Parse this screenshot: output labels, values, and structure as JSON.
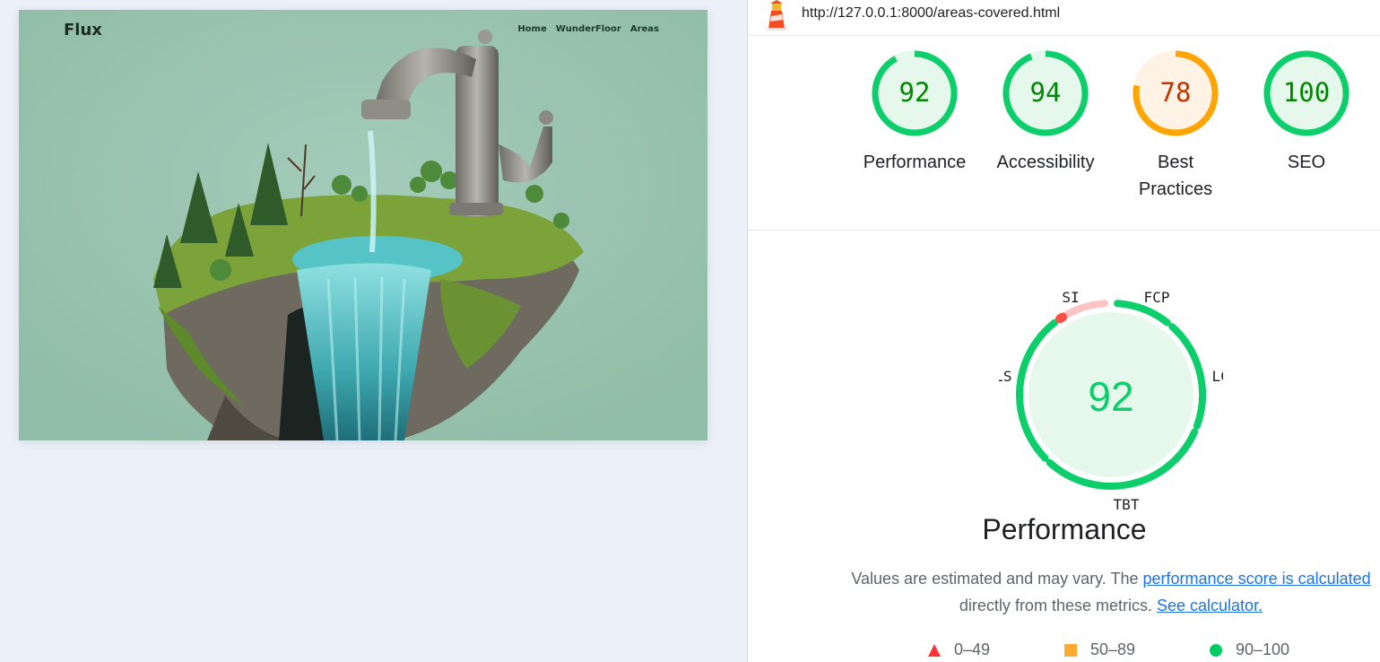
{
  "preview": {
    "brand": "Flux",
    "nav": [
      "Home",
      "WunderFloor",
      "Areas"
    ]
  },
  "report": {
    "url": "http://127.0.0.1:8000/areas-covered.html",
    "scores": [
      {
        "label": "Performance",
        "value": 92,
        "rating": "pass"
      },
      {
        "label": "Accessibility",
        "value": 94,
        "rating": "pass"
      },
      {
        "label": "Best Practices",
        "value": 78,
        "rating": "average"
      },
      {
        "label": "SEO",
        "value": 100,
        "rating": "pass"
      }
    ],
    "performance": {
      "score": 92,
      "title": "Performance",
      "metrics": [
        "SI",
        "FCP",
        "LCP",
        "TBT",
        "CLS"
      ]
    },
    "note": {
      "text1": "Values are estimated and may vary. The ",
      "link1": "performance score is calculated",
      "text2": "directly from these metrics.",
      "link2": "See calculator."
    },
    "legend": [
      {
        "shape": "triangle",
        "range": "0–49",
        "color": "#f33"
      },
      {
        "shape": "square",
        "range": "50–89",
        "color": "#fa3"
      },
      {
        "shape": "circle",
        "range": "90–100",
        "color": "#0c6"
      }
    ]
  },
  "colors": {
    "pass": "#0cce6b",
    "pass_text": "#008800",
    "pass_fill": "#e6f7ec",
    "average": "#ffa400",
    "average_text": "#c33300",
    "average_fill": "#fff3e5",
    "fail": "#ff4e42",
    "link": "#1a73e8"
  }
}
